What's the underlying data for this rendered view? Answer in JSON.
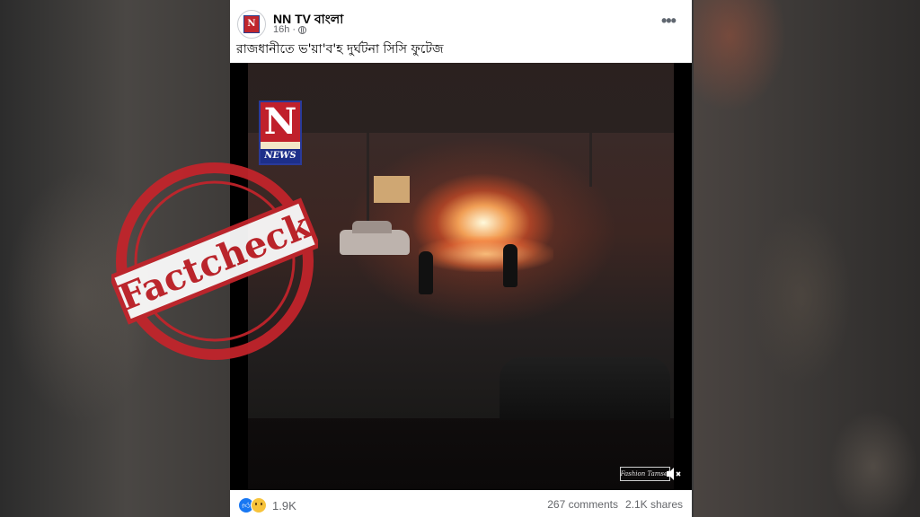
{
  "post": {
    "page_name": "NN TV বাংলা",
    "time": "16h",
    "privacy_icon": "globe-icon",
    "caption": "রাজধানীতে ভ'য়া'ব'হ দুর্ঘটনা সিসি ফুটেজ",
    "more_icon": "ellipsis-icon"
  },
  "video": {
    "logo_letter": "N",
    "logo_news": "NEWS",
    "watermark": "Fashion Tamsel",
    "mute_icon": "speaker-muted-icon"
  },
  "stats": {
    "reaction_count": "1.9K",
    "comments": "267 comments",
    "shares": "2.1K shares",
    "reaction_icons": [
      "like-icon",
      "sad-icon"
    ]
  },
  "stamp": {
    "text": "Factcheck",
    "color": "#c4242b"
  },
  "colors": {
    "facebook_blue": "#1877f2",
    "stamp_red": "#c4242b",
    "text_primary": "#050505",
    "text_secondary": "#65676b"
  }
}
